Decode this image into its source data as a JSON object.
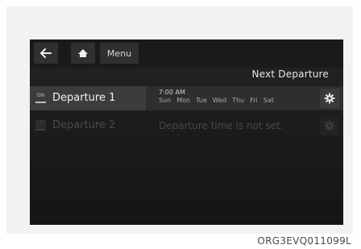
{
  "topbar": {
    "back_icon": "arrow-left-icon",
    "home_icon": "home-icon",
    "menu_label": "Menu"
  },
  "section_title": "Next Departure",
  "departures": [
    {
      "toggle_label": "ON",
      "label": "Departure 1",
      "enabled": true,
      "time": "7:00 AM",
      "days": [
        "Sun",
        "Mon",
        "Tue",
        "Wed",
        "Thu",
        "Fri",
        "Sat"
      ],
      "settings_icon": "gear-icon"
    },
    {
      "toggle_label": "OFF",
      "label": "Departure 2",
      "enabled": false,
      "status": "Departure time is not set.",
      "settings_icon": "gear-icon"
    }
  ],
  "caption": "ORG3EVQ011099L",
  "colors": {
    "screen_bg": "#1c1c1c",
    "active_row": "#3c3c3c",
    "text_primary": "#f0f0f0",
    "text_disabled": "#4a4a4a"
  }
}
